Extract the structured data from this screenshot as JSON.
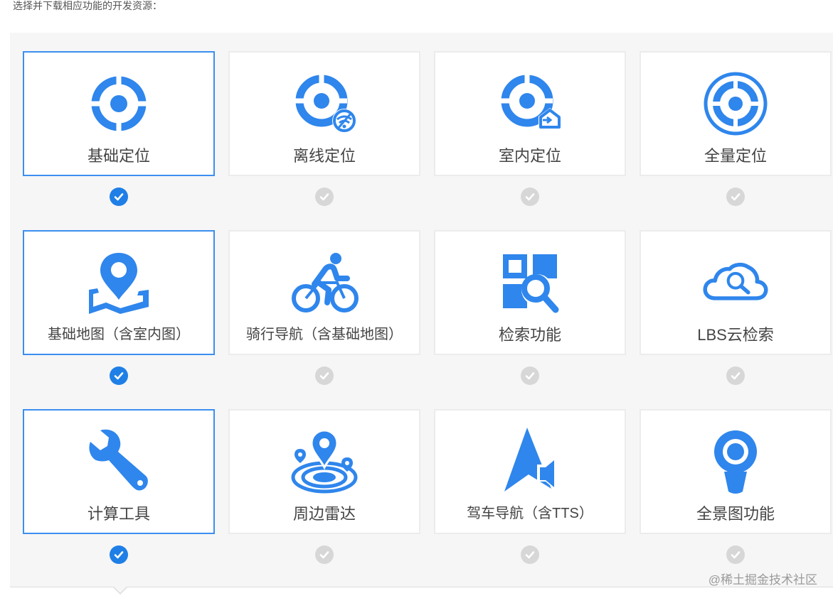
{
  "intro": "选择并下载相应功能的开发资源：",
  "colors": {
    "accent": "#3b8ff0",
    "icon": "#2f86ec",
    "check_on": "#1f7fe6",
    "check_off": "#d7d7d7"
  },
  "modules": [
    {
      "label": "基础定位",
      "icon": "location-crosshair-icon",
      "selected": true
    },
    {
      "label": "离线定位",
      "icon": "offline-location-icon",
      "selected": false
    },
    {
      "label": "室内定位",
      "icon": "indoor-location-icon",
      "selected": false
    },
    {
      "label": "全量定位",
      "icon": "full-location-icon",
      "selected": false
    },
    {
      "label": "基础地图（含室内图）",
      "icon": "map-pin-icon",
      "selected": true
    },
    {
      "label": "骑行导航（含基础地图）",
      "icon": "cyclist-icon",
      "selected": false
    },
    {
      "label": "检索功能",
      "icon": "search-grid-icon",
      "selected": false
    },
    {
      "label": "LBS云检索",
      "icon": "cloud-search-icon",
      "selected": false
    },
    {
      "label": "计算工具",
      "icon": "wrench-icon",
      "selected": true
    },
    {
      "label": "周边雷达",
      "icon": "radar-pin-icon",
      "selected": false
    },
    {
      "label": "驾车导航（含TTS）",
      "icon": "navigation-arrow-icon",
      "selected": false
    },
    {
      "label": "全景图功能",
      "icon": "panorama-icon",
      "selected": false
    }
  ],
  "watermark": "@稀土掘金技术社区"
}
